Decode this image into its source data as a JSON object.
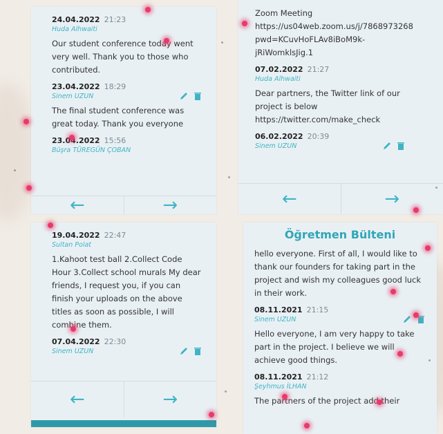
{
  "panel1": {
    "posts": [
      {
        "date": "24.04.2022",
        "time": "21:23",
        "author": "Huda Alhwaiti",
        "text": "Our student conference today went very well. Thank you to those who contributed.",
        "editable": false
      },
      {
        "date": "23.04.2022",
        "time": "18:29",
        "author": "Sinem UZUN",
        "text": "The final student conference was great today. Thank you everyone",
        "editable": true
      },
      {
        "date": "23.04.2022",
        "time": "15:56",
        "author": "Büşra TÜREGÜN ÇOBAN",
        "text": "",
        "editable": false
      }
    ],
    "prev_arrow": "←",
    "next_arrow": "→"
  },
  "panel2": {
    "top_lines": [
      "Zoom Meeting",
      "https://us04web.zoom.us/j/7868973268",
      "pwd=KCuvHoFLAv8iBoM9k-",
      "jRiWomklsJig.1"
    ],
    "posts": [
      {
        "date": "07.02.2022",
        "time": "21:27",
        "author": "Huda Alhwaiti",
        "text": "Dear partners, the Twitter link of our project is below https://twitter.com/make_check",
        "editable": false
      },
      {
        "date": "06.02.2022",
        "time": "20:39",
        "author": "Sinem UZUN",
        "text": "",
        "editable": true
      }
    ],
    "prev_arrow": "←",
    "next_arrow": "→"
  },
  "panel3": {
    "posts": [
      {
        "date": "19.04.2022",
        "time": "22:47",
        "author": "Sultan Polat",
        "text": "1.Kahoot test ball 2.Collect Code Hour 3.Collect school murals My dear friends, I request you, if you can finish your uploads on the above titles as soon as possible, I will combine them.",
        "editable": false
      },
      {
        "date": "07.04.2022",
        "time": "22:30",
        "author": "Sinem UZUN",
        "text": "",
        "editable": true
      }
    ],
    "prev_arrow": "←",
    "next_arrow": "→"
  },
  "panel4": {
    "title": "Öğretmen Bülteni",
    "intro": "hello everyone. First of all, I would like to thank our founders for taking part in the project and wish my colleagues good luck in their work.",
    "posts": [
      {
        "date": "08.11.2021",
        "time": "21:15",
        "author": "Sinem UZUN",
        "text": "Hello everyone, I am very happy to take part in the project. I believe we will achieve good things.",
        "editable": true
      },
      {
        "date": "08.11.2021",
        "time": "21:12",
        "author": "Şeyhmus İLHAN",
        "text": "The partners of the project add their",
        "editable": false
      }
    ]
  },
  "colors": {
    "accent": "#3fb4c4",
    "panel_bg": "#e9f0f4",
    "title": "#2fa6b7",
    "bar": "#2e9aa9",
    "sparkle": "#e83a6a"
  }
}
